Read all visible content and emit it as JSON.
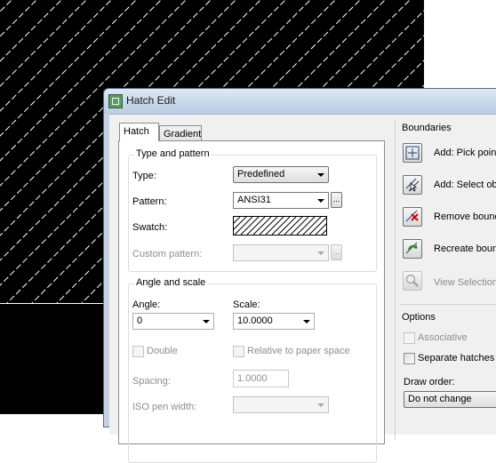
{
  "window": {
    "title": "Hatch Edit"
  },
  "tabs": [
    {
      "label": "Hatch",
      "active": true
    },
    {
      "label": "Gradient",
      "active": false
    }
  ],
  "type_and_pattern": {
    "title": "Type and pattern",
    "type_label": "Type:",
    "type_value": "Predefined",
    "pattern_label": "Pattern:",
    "pattern_value": "ANSI31",
    "pattern_button": "...",
    "swatch_label": "Swatch:",
    "custom_pattern_label": "Custom pattern:",
    "custom_pattern_value": "",
    "custom_pattern_button": "..."
  },
  "angle_and_scale": {
    "title": "Angle and scale",
    "angle_label": "Angle:",
    "angle_value": "0",
    "scale_label": "Scale:",
    "scale_value": "10.0000",
    "double_label": "Double",
    "relative_label": "Relative to paper space",
    "spacing_label": "Spacing:",
    "spacing_value": "1.0000",
    "iso_pen_label": "ISO pen width:",
    "iso_pen_value": ""
  },
  "boundaries": {
    "title": "Boundaries",
    "items": [
      {
        "label": "Add: Pick point",
        "icon": "pick-points-icon",
        "enabled": true
      },
      {
        "label": "Add: Select obj",
        "icon": "select-objects-icon",
        "enabled": true
      },
      {
        "label": "Remove bound",
        "icon": "remove-boundaries-icon",
        "enabled": true
      },
      {
        "label": "Recreate boun",
        "icon": "recreate-boundary-icon",
        "enabled": true
      },
      {
        "label": "View Selection",
        "icon": "magnifier-icon",
        "enabled": false
      }
    ]
  },
  "options": {
    "title": "Options",
    "associative_label": "Associative",
    "separate_label": "Separate hatches",
    "draw_order_label": "Draw order:",
    "draw_order_value": "Do not change"
  },
  "colors": {
    "canvas": "#000000",
    "hatch_lines": "#ffffff",
    "dialog_bg": "#f0f0f0",
    "titlebar": "#c7d6ea"
  }
}
